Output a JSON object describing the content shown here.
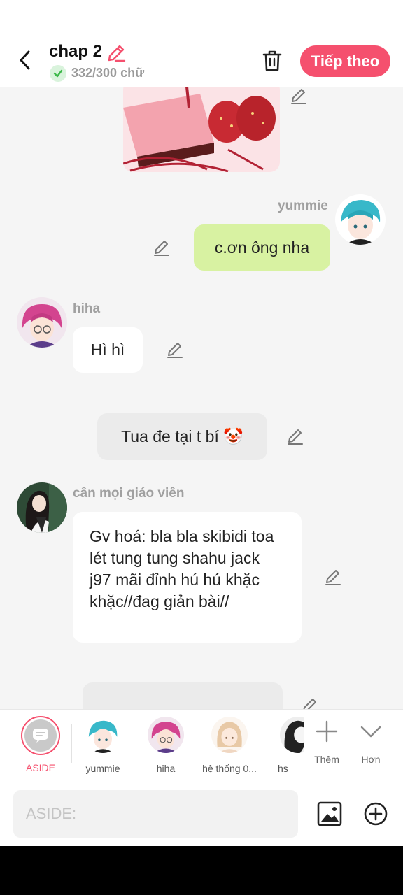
{
  "header": {
    "title": "chap 2",
    "word_count": "332/300 chữ",
    "next_label": "Tiếp theo"
  },
  "messages": [
    {
      "type": "image",
      "alt": "cake"
    },
    {
      "type": "right",
      "sender": "yummie",
      "text": "c.ơn ông nha"
    },
    {
      "type": "left",
      "sender": "hiha",
      "text": "Hì hì"
    },
    {
      "type": "aside",
      "text": "Tua đe tại t bí 🤡"
    },
    {
      "type": "left",
      "sender": "cân mọi giáo viên",
      "text": "Gv hoá: bla bla skibidi toa lét tung tung shahu jack j97 mãi đỉnh hú hú khặc khặc//đag giản bài//"
    }
  ],
  "toolbar": {
    "aside_label": "ASIDE",
    "characters": [
      "yummie",
      "hiha",
      "hệ thống 0...",
      "hs"
    ],
    "add_label": "Thêm",
    "more_label": "Hơn"
  },
  "input": {
    "placeholder": "ASIDE:"
  },
  "colors": {
    "accent": "#f5506e",
    "green_bubble": "#d8f2a2",
    "background": "#f5f5f5"
  },
  "icons": [
    "back-icon",
    "pencil-icon",
    "check-icon",
    "trash-icon",
    "plus-icon",
    "chevron-down-icon",
    "image-icon",
    "add-circle-icon"
  ]
}
